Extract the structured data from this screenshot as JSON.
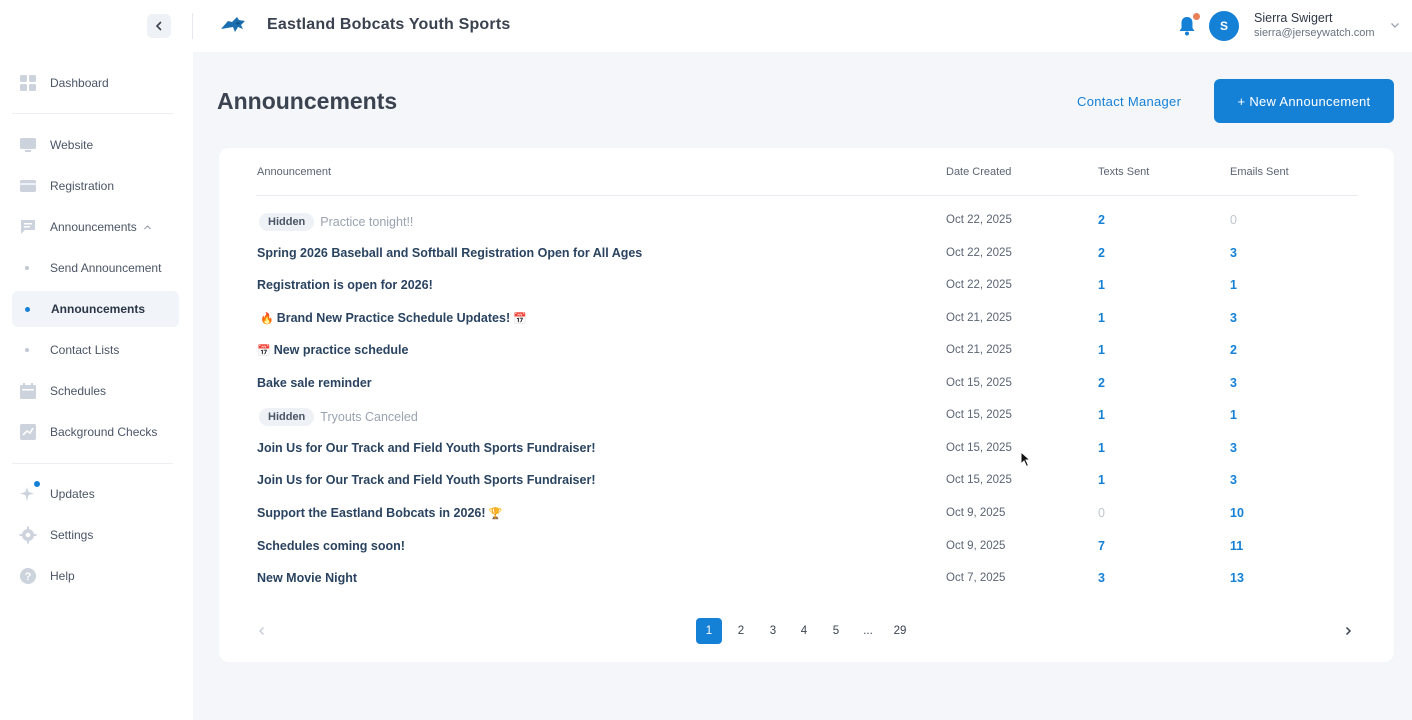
{
  "header": {
    "org_name": "Eastland Bobcats Youth Sports",
    "user_initial": "S",
    "user_name": "Sierra Swigert",
    "user_email": "sierra@jerseywatch.com"
  },
  "sidebar": {
    "items": [
      {
        "label": "Dashboard",
        "icon": "dashboard-icon"
      },
      {
        "label": "Website",
        "icon": "monitor-icon"
      },
      {
        "label": "Registration",
        "icon": "card-icon"
      },
      {
        "label": "Announcements",
        "icon": "message-icon"
      },
      {
        "label": "Send Announcement"
      },
      {
        "label": "Announcements"
      },
      {
        "label": "Contact Lists"
      },
      {
        "label": "Schedules",
        "icon": "calendar-icon"
      },
      {
        "label": "Background Checks",
        "icon": "chart-icon"
      },
      {
        "label": "Updates",
        "icon": "sparkle-icon"
      },
      {
        "label": "Settings",
        "icon": "gear-icon"
      },
      {
        "label": "Help",
        "icon": "help-icon"
      }
    ]
  },
  "page": {
    "title": "Announcements",
    "contact_manager": "Contact Manager",
    "new_announcement": "+ New Announcement"
  },
  "table": {
    "headers": {
      "announcement": "Announcement",
      "date_created": "Date Created",
      "texts_sent": "Texts Sent",
      "emails_sent": "Emails Sent"
    },
    "hidden_label": "Hidden",
    "rows": [
      {
        "title": "Practice tonight!!",
        "date": "Oct 22, 2025",
        "texts": "2",
        "emails": "0"
      },
      {
        "title": "Spring 2026 Baseball and Softball Registration Open for All Ages",
        "date": "Oct 22, 2025",
        "texts": "2",
        "emails": "3"
      },
      {
        "title": "Registration is open for 2026!",
        "date": "Oct 22, 2025",
        "texts": "1",
        "emails": "1"
      },
      {
        "title": "Brand New Practice Schedule Updates!",
        "date": "Oct 21, 2025",
        "texts": "1",
        "emails": "3"
      },
      {
        "title": "New practice schedule",
        "date": "Oct 21, 2025",
        "texts": "1",
        "emails": "2"
      },
      {
        "title": "Bake sale reminder",
        "date": "Oct 15, 2025",
        "texts": "2",
        "emails": "3"
      },
      {
        "title": "Tryouts Canceled",
        "date": "Oct 15, 2025",
        "texts": "1",
        "emails": "1"
      },
      {
        "title": "Join Us for Our Track and Field Youth Sports Fundraiser!",
        "date": "Oct 15, 2025",
        "texts": "1",
        "emails": "3"
      },
      {
        "title": "Join Us for Our Track and Field Youth Sports Fundraiser!",
        "date": "Oct 15, 2025",
        "texts": "1",
        "emails": "3"
      },
      {
        "title": "Support the Eastland Bobcats in 2026!",
        "date": "Oct 9, 2025",
        "texts": "0",
        "emails": "10"
      },
      {
        "title": "Schedules coming soon!",
        "date": "Oct 9, 2025",
        "texts": "7",
        "emails": "11"
      },
      {
        "title": "New Movie Night",
        "date": "Oct 7, 2025",
        "texts": "3",
        "emails": "13"
      }
    ]
  },
  "pagination": {
    "pages": [
      "1",
      "2",
      "3",
      "4",
      "5",
      "...",
      "29"
    ],
    "current": "1"
  },
  "colors": {
    "accent": "#1581d6",
    "title_text": "#2a4360",
    "muted": "#9aa3b0",
    "background": "#f4f6f9"
  }
}
